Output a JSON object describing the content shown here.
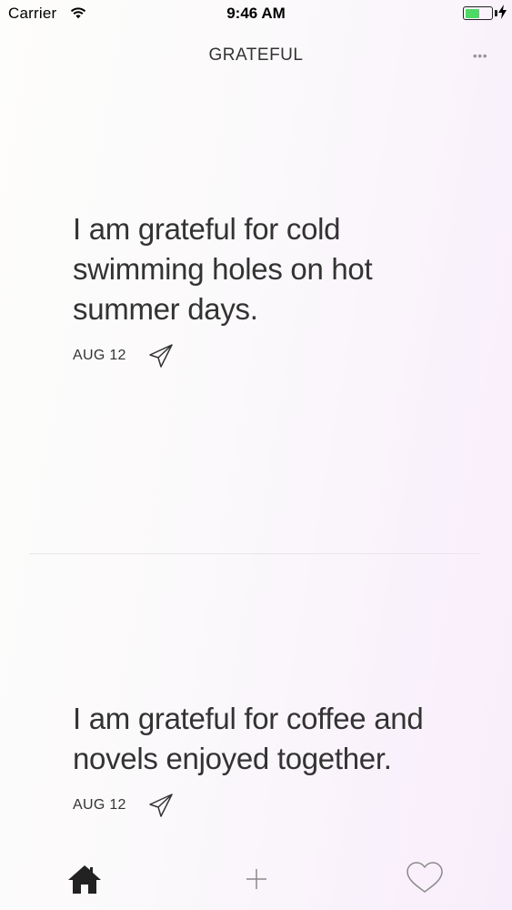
{
  "status_bar": {
    "carrier": "Carrier",
    "time": "9:46 AM",
    "battery_level": 0.55,
    "battery_color": "#4cd964"
  },
  "nav": {
    "title": "GRATEFUL",
    "more_label": "•••"
  },
  "entries": [
    {
      "text": "I am grateful for cold swimming holes on hot summer days.",
      "date": "AUG 12",
      "share_icon": "paper-plane-icon"
    },
    {
      "text": "I am grateful for coffee and novels enjoyed together.",
      "date": "AUG 12",
      "share_icon": "paper-plane-icon"
    }
  ],
  "tab_bar": {
    "tabs": [
      {
        "icon": "home-icon",
        "active": true
      },
      {
        "icon": "plus-icon",
        "active": false
      },
      {
        "icon": "heart-icon",
        "active": false
      }
    ]
  }
}
